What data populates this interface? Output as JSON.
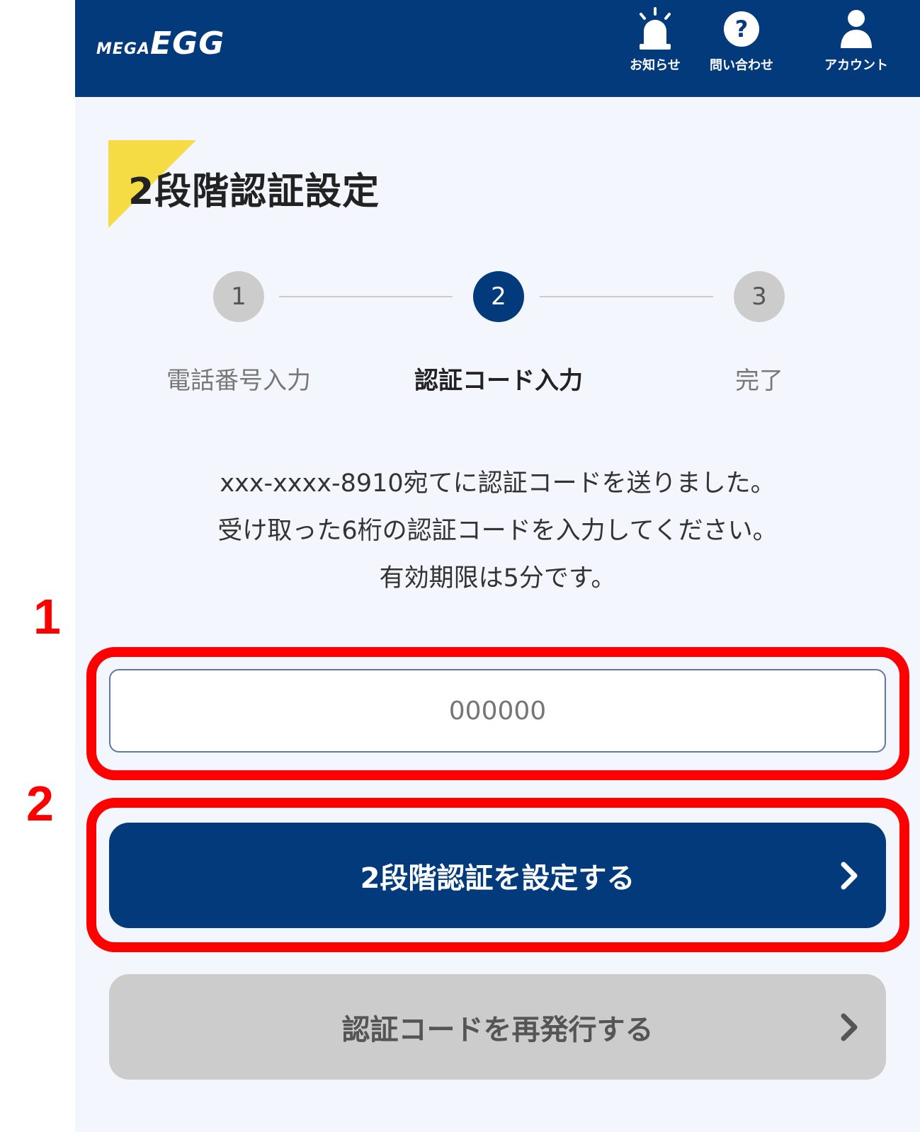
{
  "annotations": {
    "marker_1": "1",
    "marker_2": "2"
  },
  "header": {
    "logo_small": "MEGA",
    "logo_big": "EGG",
    "notice_label": "お知らせ",
    "contact_label": "問い合わせ",
    "account_label": "アカウント"
  },
  "page": {
    "title": "2段階認証設定"
  },
  "stepper": {
    "steps": [
      {
        "number": "1",
        "label": "電話番号入力",
        "state": "done"
      },
      {
        "number": "2",
        "label": "認証コード入力",
        "state": "current"
      },
      {
        "number": "3",
        "label": "完了",
        "state": "pending"
      }
    ]
  },
  "message": {
    "line1": "xxx-xxxx-8910宛てに認証コードを送りました。",
    "line2": "受け取った6桁の認証コードを入力してください。",
    "line3": "有効期限は5分です。"
  },
  "form": {
    "code_placeholder": "000000",
    "submit_label": "2段階認証を設定する",
    "resend_label": "認証コードを再発行する"
  },
  "colors": {
    "brand_navy": "#023a7c",
    "accent_yellow": "#f5dc44",
    "highlight_red": "#ff0000",
    "disabled_gray": "#cccccc"
  }
}
